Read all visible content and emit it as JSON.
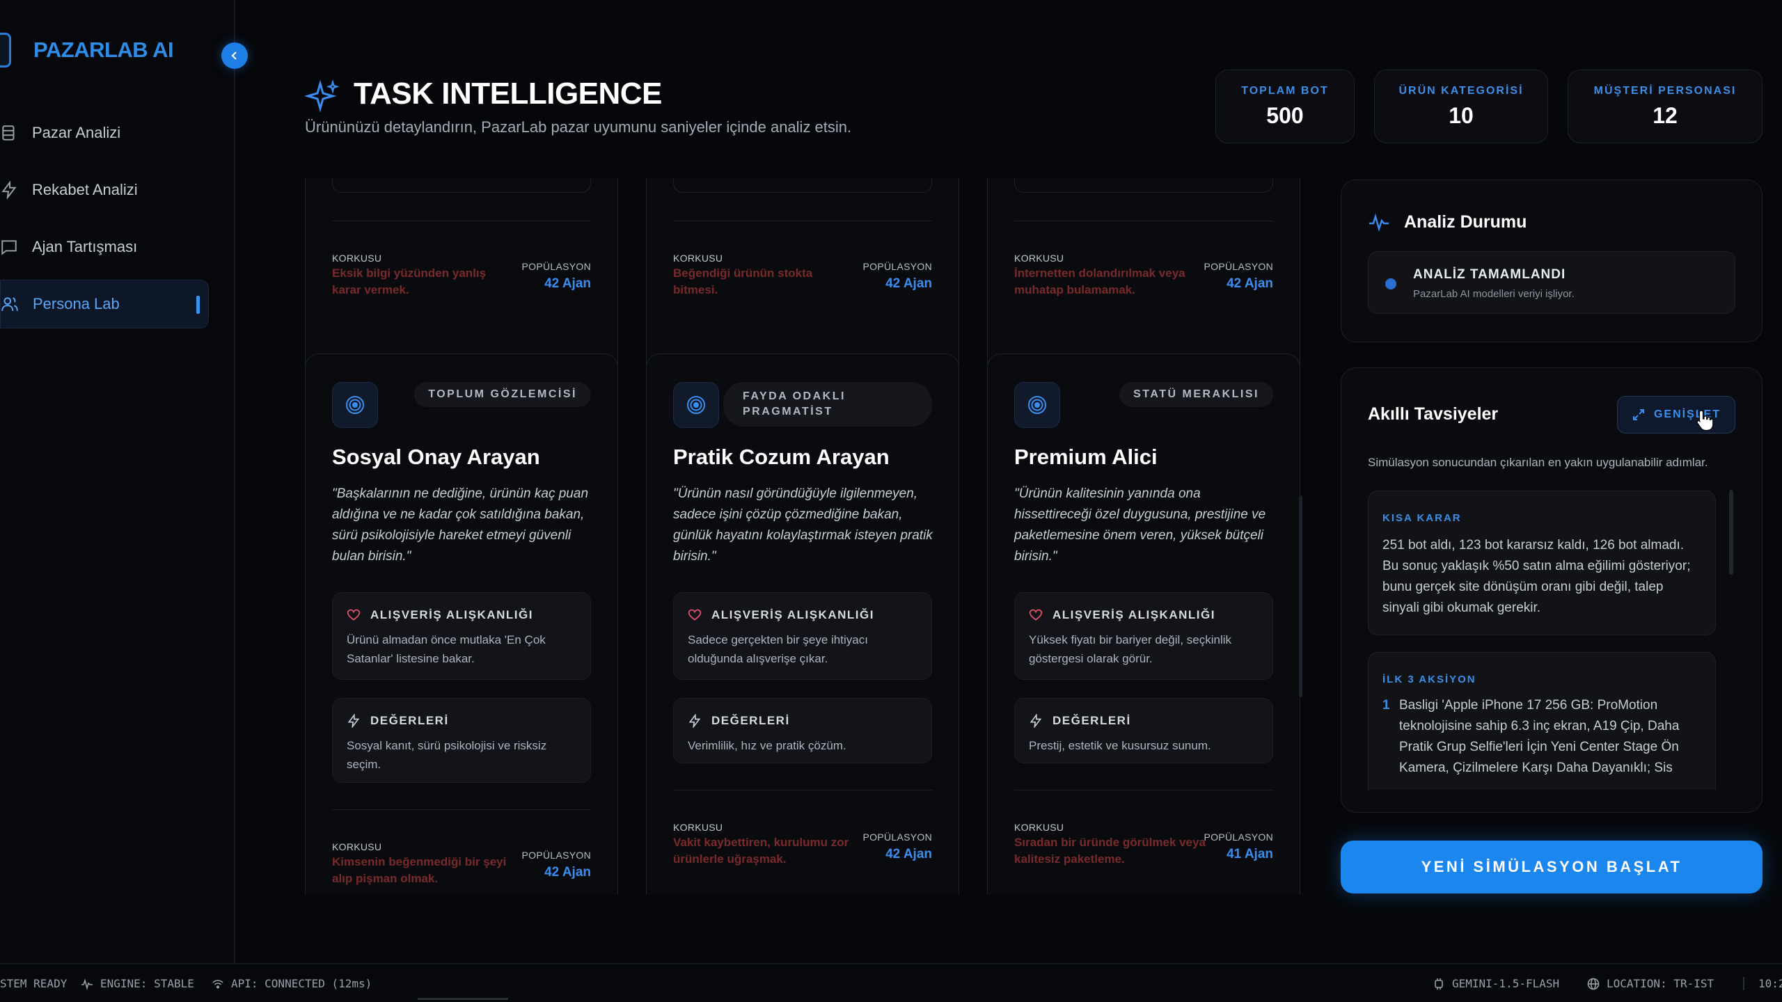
{
  "app": {
    "name": "PAZARLAB AI"
  },
  "sidebar": {
    "items": [
      {
        "label": "Pazar Analizi",
        "icon": "storefront-icon",
        "active": false
      },
      {
        "label": "Rekabet Analizi",
        "icon": "lightning-icon",
        "active": false
      },
      {
        "label": "Ajan Tartışması",
        "icon": "chat-icon",
        "active": false
      },
      {
        "label": "Persona Lab",
        "icon": "users-icon",
        "active": true
      }
    ]
  },
  "header": {
    "title": "TASK INTELLIGENCE",
    "subtitle": "Ürününüzü detaylandırın, PazarLab pazar uyumunu saniyeler içinde analiz etsin."
  },
  "stats": [
    {
      "label": "TOPLAM BOT",
      "value": "500"
    },
    {
      "label": "ÜRÜN KATEGORİSİ",
      "value": "10"
    },
    {
      "label": "MÜŞTERİ PERSONASI",
      "value": "12"
    }
  ],
  "top_cards": [
    {
      "fear_label": "KORKUSU",
      "fear": "Eksik bilgi yüzünden yanlış karar vermek.",
      "pop_label": "POPÜLASYON",
      "pop": "42 Ajan"
    },
    {
      "fear_label": "KORKUSU",
      "fear": "Beğendiği ürünün stokta bitmesi.",
      "pop_label": "POPÜLASYON",
      "pop": "42 Ajan"
    },
    {
      "fear_label": "KORKUSU",
      "fear": "İnternetten dolandırılmak veya muhatap bulamamak.",
      "pop_label": "POPÜLASYON",
      "pop": "42 Ajan"
    }
  ],
  "personas": [
    {
      "tag": "TOPLUM GÖZLEMCİSİ",
      "title": "Sosyal Onay Arayan",
      "quote": "\"Başkalarının ne dediğine, ürünün kaç puan aldığına ve ne kadar çok satıldığına bakan, sürü psikolojisiyle hareket etmeyi güvenli bulan birisin.\"",
      "habit_label": "ALIŞVERİŞ ALIŞKANLIĞI",
      "habit": "Ürünü almadan önce mutlaka 'En Çok Satanlar' listesine bakar.",
      "values_label": "DEĞERLERİ",
      "values": "Sosyal kanıt, sürü psikolojisi ve risksiz seçim.",
      "fear_label": "KORKUSU",
      "fear": "Kimsenin beğenmediği bir şeyi alıp pişman olmak.",
      "pop_label": "POPÜLASYON",
      "pop": "42 Ajan"
    },
    {
      "tag": "FAYDA ODAKLI PRAGMATİST",
      "title": "Pratik Cozum Arayan",
      "quote": "\"Ürünün nasıl göründüğüyle ilgilenmeyen, sadece işini çözüp çözmediğine bakan, günlük hayatını kolaylaştırmak isteyen pratik birisin.\"",
      "habit_label": "ALIŞVERİŞ ALIŞKANLIĞI",
      "habit": "Sadece gerçekten bir şeye ihtiyacı olduğunda alışverişe çıkar.",
      "values_label": "DEĞERLERİ",
      "values": "Verimlilik, hız ve pratik çözüm.",
      "fear_label": "KORKUSU",
      "fear": "Vakit kaybettiren, kurulumu zor ürünlerle uğraşmak.",
      "pop_label": "POPÜLASYON",
      "pop": "42 Ajan"
    },
    {
      "tag": "STATÜ MERAKLISI",
      "title": "Premium Alici",
      "quote": "\"Ürünün kalitesinin yanında ona hissettireceği özel duygusuna, prestijine ve paketlemesine önem veren, yüksek bütçeli birisin.\"",
      "habit_label": "ALIŞVERİŞ ALIŞKANLIĞI",
      "habit": "Yüksek fiyatı bir bariyer değil, seçkinlik göstergesi olarak görür.",
      "values_label": "DEĞERLERİ",
      "values": "Prestij, estetik ve kusursuz sunum.",
      "fear_label": "KORKUSU",
      "fear": "Sıradan bir üründe görülmek veya kalitesiz paketleme.",
      "pop_label": "POPÜLASYON",
      "pop": "41 Ajan"
    }
  ],
  "analysis_status": {
    "title": "Analiz Durumu",
    "state": "ANALİZ TAMAMLANDI",
    "detail": "PazarLab AI modelleri veriyi işliyor."
  },
  "recommendations": {
    "title": "Akıllı Tavsiyeler",
    "expand_label": "GENİŞLET",
    "description": "Simülasyon sonucundan çıkarılan en yakın uygulanabilir adımlar.",
    "short_decision_label": "KISA KARAR",
    "short_decision": "251 bot aldı, 123 bot kararsız kaldı, 126 bot almadı. Bu sonuç yaklaşık %50 satın alma eğilimi gösteriyor; bunu gerçek site dönüşüm oranı gibi değil, talep sinyali gibi okumak gerekir.",
    "actions_label": "İLK 3 AKSİYON",
    "actions": [
      {
        "num": "1",
        "text": "Basligi 'Apple iPhone 17 256 GB: ProMotion teknolojisine sahip 6.3 inç ekran, A19 Çip, Daha Pratik Grup Selfie'leri İçin Yeni Center Stage Ön Kamera, Çizilmelere Karşı Daha Dayanıklı; Sis"
      }
    ]
  },
  "cta_label": "YENİ SİMÜLASYON BAŞLAT",
  "statusbar": {
    "system": "STEM READY",
    "engine": "ENGINE: STABLE",
    "api": "API: CONNECTED (12ms)",
    "model": "GEMINI-1.5-FLASH",
    "location": "LOCATION: TR-IST",
    "time": "10:2"
  },
  "colors": {
    "accent": "#1a86ee",
    "accent_text": "#3b8ef0",
    "danger_text": "#7a2a2a",
    "background": "#06070a"
  }
}
